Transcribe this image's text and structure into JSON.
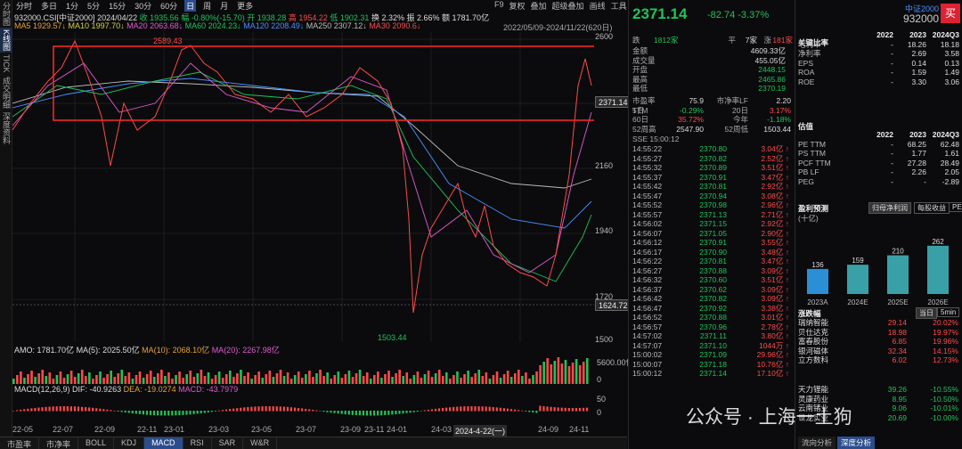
{
  "left_tabs": [
    "分时图",
    "K线图",
    "TICK",
    "成交明细",
    "深度资料"
  ],
  "toolbar": {
    "items": [
      "分时",
      "多日",
      "1分",
      "5分",
      "15分",
      "30分",
      "60分",
      "日",
      "周",
      "月",
      "更多"
    ],
    "active": "日"
  },
  "right_tools": [
    "F9",
    "复权",
    "叠加",
    "超级叠加",
    "画线",
    "工具"
  ],
  "info_line": {
    "code": "932000.CSI[中证2000]",
    "date": "2024/04/22",
    "close": "收 1935.56",
    "change": "幅 -0.80%(-15.70)",
    "open": "开 1938.28",
    "high": "高 1954.22",
    "low": "低 1902.31",
    "turnover": "换 2.32%",
    "amplitude": "振 2.66%",
    "amount": "额 1781.70亿"
  },
  "ma_line": [
    {
      "label": "MA5",
      "value": "1929.57↓",
      "color": "#e5a23a"
    },
    {
      "label": "MA10",
      "value": "1997.70↓",
      "color": "#d8d24a"
    },
    {
      "label": "MA20",
      "value": "2063.68↓",
      "color": "#e05bd0"
    },
    {
      "label": "MA60",
      "value": "2024.23↓",
      "color": "#1fc35a"
    },
    {
      "label": "MA120",
      "value": "2208.49↓",
      "color": "#4a90ff"
    },
    {
      "label": "MA250",
      "value": "2307.12↓",
      "color": "#bbbbbb"
    },
    {
      "label": "MA30",
      "value": "2090.6↓",
      "color": "#ff4a4a"
    }
  ],
  "date_range": "2022/05/09-2024/11/22(620日)",
  "y_ticks": [
    "2600",
    "2380",
    "2160",
    "1940",
    "1720",
    "1500"
  ],
  "price_tag_current": "2371.14",
  "price_tag_low": "1624.72",
  "annotation_high": "2589.43",
  "annotation_low": "1503.44",
  "amo_line": {
    "amo": "AMO: 1781.70亿",
    "ma5": "MA(5): 2025.50亿",
    "ma10": "MA(10): 2068.10亿",
    "ma20": "MA(20): 2267.98亿"
  },
  "amo_ticks": [
    "5600.00亿",
    "0"
  ],
  "macd_line": {
    "title": "MACD(12,26,9)",
    "dif": "DIF: -40.9263",
    "dea": "DEA: -19.0274",
    "macd": "MACD: -43.7979"
  },
  "macd_ticks": [
    "50",
    "0"
  ],
  "x_ticks": [
    "22-05",
    "22-07",
    "22-09",
    "22-11",
    "23-01",
    "23-03",
    "23-05",
    "23-07",
    "23-09",
    "23-11",
    "24-01",
    "24-03",
    "2024-4-22(一)",
    "24-09",
    "24-11"
  ],
  "bottom_tabs": [
    "市盈率",
    "市净率",
    "BOLL",
    "KDJ",
    "MACD",
    "RSI",
    "SAR",
    "W&R"
  ],
  "bottom_active": "MACD",
  "quote": {
    "price": "2371.14",
    "change": "-82.74",
    "pct": "-3.37%"
  },
  "breadth": {
    "up_label": "跌",
    "down": "1812家",
    "flat_label": "平",
    "flat": "7家",
    "rise_label": "涨",
    "rise": "181家"
  },
  "stats": [
    {
      "k": "金额",
      "v": "4609.33亿",
      "c": "#dddddd"
    },
    {
      "k": "成交量",
      "v": "455.05亿",
      "c": "#dddddd"
    },
    {
      "k": "开盘",
      "v": "2448.15",
      "c": "#1fc35a"
    },
    {
      "k": "最高",
      "v": "2465.86",
      "c": "#1fc35a"
    },
    {
      "k": "最低",
      "v": "2370.19",
      "c": "#1fc35a"
    }
  ],
  "valuation": [
    {
      "k": "市盈率TTM",
      "v": "75.9",
      "k2": "市净率LF",
      "v2": "2.20",
      "c": "#dddddd",
      "c2": "#dddddd"
    },
    {
      "k": "5日",
      "v": "-0.29%",
      "k2": "20日",
      "v2": "3.17%",
      "c": "#1fc35a",
      "c2": "#ff4a4a"
    },
    {
      "k": "60日",
      "v": "35.72%",
      "k2": "今年",
      "v2": "-1.18%",
      "c": "#ff4a4a",
      "c2": "#1fc35a"
    },
    {
      "k": "52周高",
      "v": "2547.90",
      "k2": "52周低",
      "v2": "1503.44",
      "c": "#dddddd",
      "c2": "#dddddd"
    }
  ],
  "ticks": [
    {
      "t": "14:55:22",
      "p": "2370.80",
      "v": "3.04亿"
    },
    {
      "t": "14:55:27",
      "p": "2370.82",
      "v": "2.52亿"
    },
    {
      "t": "14:55:32",
      "p": "2370.89",
      "v": "3.51亿"
    },
    {
      "t": "14:55:37",
      "p": "2370.91",
      "v": "3.47亿"
    },
    {
      "t": "14:55:42",
      "p": "2370.81",
      "v": "2.92亿"
    },
    {
      "t": "14:55:47",
      "p": "2370.94",
      "v": "3.08亿"
    },
    {
      "t": "14:55:52",
      "p": "2370.98",
      "v": "2.96亿"
    },
    {
      "t": "14:55:57",
      "p": "2371.13",
      "v": "2.71亿"
    },
    {
      "t": "14:56:02",
      "p": "2371.15",
      "v": "2.92亿"
    },
    {
      "t": "14:56:07",
      "p": "2371.05",
      "v": "2.90亿"
    },
    {
      "t": "14:56:12",
      "p": "2370.91",
      "v": "3.55亿"
    },
    {
      "t": "14:56:17",
      "p": "2370.90",
      "v": "3.48亿"
    },
    {
      "t": "14:56:22",
      "p": "2370.81",
      "v": "3.47亿"
    },
    {
      "t": "14:56:27",
      "p": "2370.88",
      "v": "3.09亿"
    },
    {
      "t": "14:56:32",
      "p": "2370.60",
      "v": "3.51亿"
    },
    {
      "t": "14:56:37",
      "p": "2370.62",
      "v": "3.09亿"
    },
    {
      "t": "14:56:42",
      "p": "2370.82",
      "v": "3.09亿"
    },
    {
      "t": "14:56:47",
      "p": "2370.92",
      "v": "3.38亿"
    },
    {
      "t": "14:56:52",
      "p": "2370.88",
      "v": "3.01亿"
    },
    {
      "t": "14:56:57",
      "p": "2370.96",
      "v": "2.78亿"
    },
    {
      "t": "14:57:02",
      "p": "2371.11",
      "v": "3.80亿"
    },
    {
      "t": "14:57:07",
      "p": "2371.10",
      "v": "1044万"
    },
    {
      "t": "15:00:02",
      "p": "2371.09",
      "v": "29.96亿"
    },
    {
      "t": "15:00:07",
      "p": "2371.18",
      "v": "10.76亿"
    },
    {
      "t": "15:00:12",
      "p": "2371.14",
      "v": "17.10亿"
    }
  ],
  "sse_line": "SSE 15:00:12",
  "right": {
    "title": "中证2000",
    "code": "932000",
    "buy": "买",
    "key_ratio_title": "关键比率",
    "years": [
      "2022",
      "2023",
      "2024Q3"
    ],
    "key_ratios": [
      {
        "k": "毛利率",
        "v": [
          "-",
          "18.26",
          "18.18"
        ]
      },
      {
        "k": "净利率",
        "v": [
          "-",
          "2.69",
          "3.58"
        ]
      },
      {
        "k": "EPS",
        "v": [
          "-",
          "0.14",
          "0.13"
        ]
      },
      {
        "k": "ROA",
        "v": [
          "-",
          "1.59",
          "1.49"
        ]
      },
      {
        "k": "ROE",
        "v": [
          "-",
          "3.30",
          "3.06"
        ]
      }
    ],
    "valuation_title": "估值",
    "valuation_rows": [
      {
        "k": "PE TTM",
        "v": [
          "-",
          "68.25",
          "62.48"
        ]
      },
      {
        "k": "PS TTM",
        "v": [
          "-",
          "1.77",
          "1.61"
        ]
      },
      {
        "k": "PCF TTM",
        "v": [
          "-",
          "27.28",
          "28.49"
        ]
      },
      {
        "k": "PB LF",
        "v": [
          "-",
          "2.26",
          "2.05"
        ]
      },
      {
        "k": "PEG",
        "v": [
          "-",
          "-",
          "-2.89"
        ]
      }
    ],
    "forecast_title": "盈利预测",
    "forecast_unit": "(十亿)",
    "forecast_tabs": [
      "归母净利润",
      "每股收益",
      "PE"
    ],
    "forecast_bars": [
      {
        "label": "2023A",
        "value": 136,
        "color": "#2b8fd6"
      },
      {
        "label": "2024E",
        "value": 159,
        "color": "#3aa0a8"
      },
      {
        "label": "2025E",
        "value": 210,
        "color": "#3aa0a8"
      },
      {
        "label": "2026E",
        "value": 262,
        "color": "#3aa0a8"
      }
    ],
    "hot_title": "涨跌幅",
    "hot_tabs": [
      "当日",
      "5min"
    ],
    "hot": [
      {
        "n": "瑞纳智能",
        "p": "29.14",
        "c": "20.02%"
      },
      {
        "n": "贝仕达克",
        "p": "18.98",
        "c": "19.97%"
      },
      {
        "n": "富春股份",
        "p": "6.85",
        "c": "19.96%"
      },
      {
        "n": "银河磁体",
        "p": "32.34",
        "c": "14.15%"
      },
      {
        "n": "立方数科",
        "p": "6.02",
        "c": "12.73%"
      }
    ],
    "hot2": [
      {
        "n": "天力锂能",
        "p": "39.26",
        "c": "-10.55%"
      },
      {
        "n": "灵康药业",
        "p": "8.95",
        "c": "-10.50%"
      },
      {
        "n": "云南锗业",
        "p": "9.06",
        "c": "-10.01%"
      },
      {
        "n": "世龙实业",
        "p": "20.69",
        "c": "-10.00%"
      }
    ],
    "bottom_tabs": [
      "流向分析",
      "深度分析"
    ],
    "bottom_active": "深度分析"
  },
  "watermark": "公众号 · 上海一土狗",
  "colors": {
    "up": "#ff4a4a",
    "down": "#1fc35a",
    "accent": "#2c4d8c",
    "highlight_box": "#ff2a2a"
  }
}
